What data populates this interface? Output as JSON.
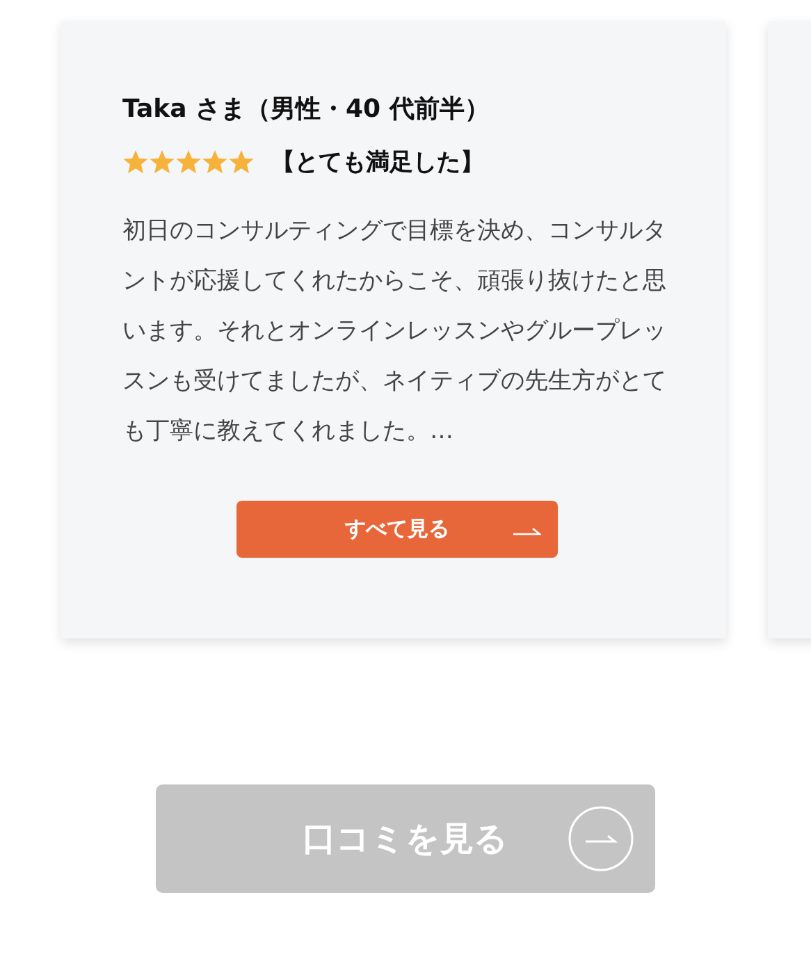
{
  "reviews": [
    {
      "reviewer": "Taka さま（男性・40 代前半）",
      "stars": 5,
      "rating_label": "【とても満足した】",
      "comment": "初日のコンサルティングで目標を決め、コンサルタントが応援してくれたからこそ、頑張り抜けたと思います。それとオンラインレッスンやグループレッスンも受けてましたが、ネイティブの先生方がとても丁寧に教えてくれました。…",
      "button": "すべて見る"
    }
  ],
  "more_button": {
    "label": "口コミを見る",
    "disabled": true
  }
}
